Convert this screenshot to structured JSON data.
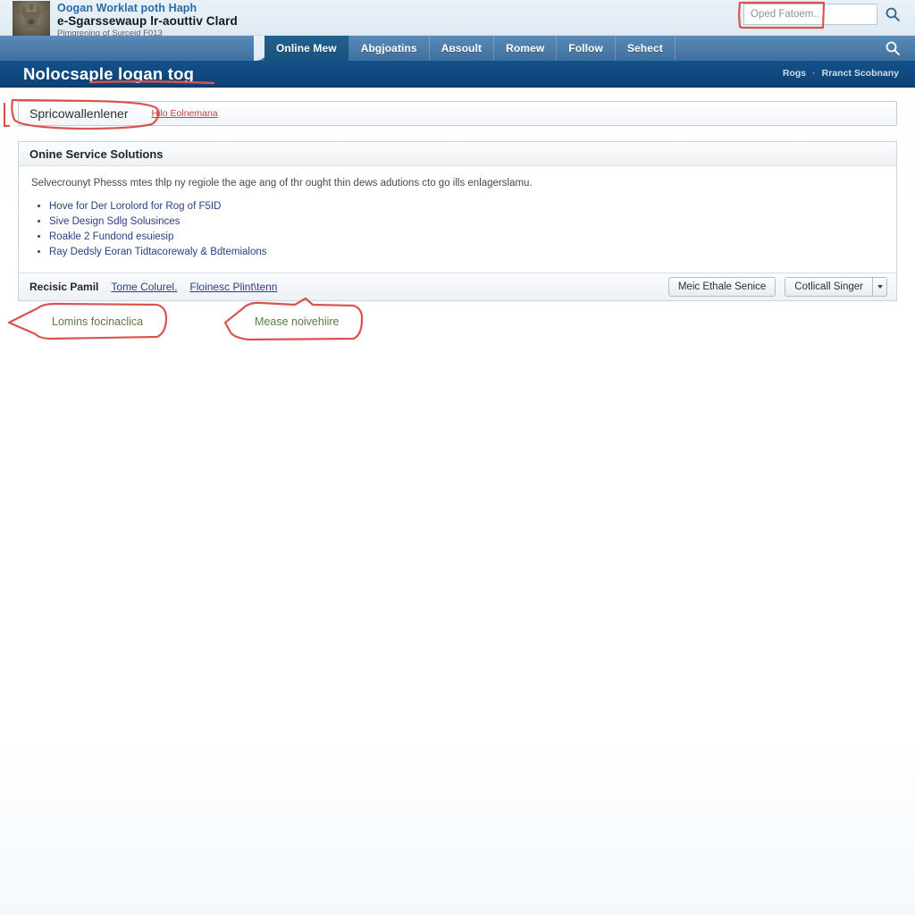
{
  "header": {
    "brand_line1": "Oogan Worklat poth Haph",
    "brand_line2": "e-Sgarssewaup lr-aouttiv Clard",
    "brand_line3": "Pimgrening of Surceid F013",
    "emblem_icon": "national-emblem-icon",
    "search": {
      "placeholder": "Oped Fatoem..",
      "value": "",
      "icon": "search-icon"
    }
  },
  "nav": {
    "tabs": [
      {
        "label": "Online Mew",
        "active": true
      },
      {
        "label": "Abgjoatins",
        "active": false
      },
      {
        "label": "Aвsoult",
        "active": false
      },
      {
        "label": "Romew",
        "active": false
      },
      {
        "label": "Follow",
        "active": false
      },
      {
        "label": "Sehect",
        "active": false
      }
    ],
    "search_icon": "search-icon"
  },
  "title_bar": {
    "title": "Nolocsaple logan tog",
    "right_items": [
      "Rogs",
      "Rranct Scobnany"
    ],
    "separator": "·"
  },
  "selector": {
    "value": "Spricowallenlener",
    "help_link": "Hilo Eolnemana",
    "caret_icon": "chevron-down-icon"
  },
  "card": {
    "header_title": "Onine Service Solutions",
    "intro": "Selvecrounyt Phesss mtes thlp ny regiole the age ang of thr ought thin dews adutions cto go ills enlagerslamu.",
    "list_items": [
      "Hove for Der Lorolord for Rog of F5ID",
      "Sive Design Sdlg Solusinces",
      "Roakle 2 Fundond esuiesip",
      "Ray Dedsly Eoran Tidtacorewaly & Bdtemialons"
    ],
    "footer": {
      "label": "Recisic Pamil",
      "links": [
        "Tome Colurel.",
        "Floinesc Plint\\tenn"
      ],
      "primary_button": "Meic Ethale Senice",
      "split_button": "Cotlicall Singer",
      "split_caret_icon": "chevron-down-icon"
    }
  },
  "annotations": {
    "search_box_highlight": "red-rectangle-annotation",
    "title_underline": "red-underline-annotation",
    "selector_highlight": "red-oval-annotation",
    "callouts": [
      {
        "text": "Lomins focinaclica",
        "shape": "red-arrow-callout-left"
      },
      {
        "text": "Mease noivehiire",
        "shape": "red-arrow-callout-left"
      }
    ]
  },
  "colors": {
    "brand_blue": "#2a6aa8",
    "title_bar_blue": "#125189",
    "nav_blue": "#4a7fae",
    "active_tab_blue": "#17527f",
    "link_blue": "#2b3f84",
    "annotation_red": "#d9534f",
    "callout_text_green": "#5f7b41",
    "help_link_red": "#c2414a"
  }
}
